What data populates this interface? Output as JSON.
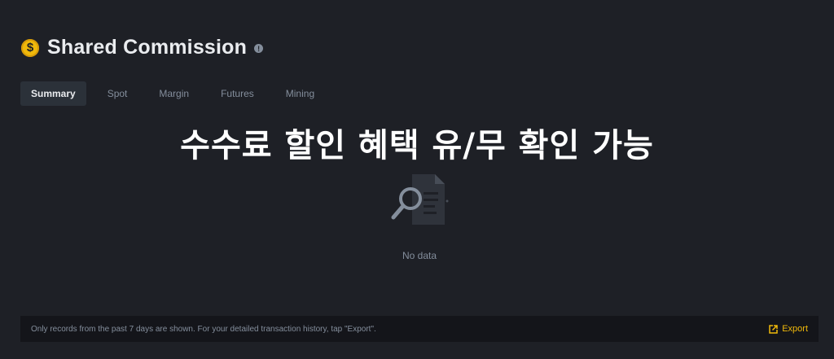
{
  "header": {
    "coin_symbol": "$",
    "title": "Shared Commission",
    "info_glyph": "!"
  },
  "tabs": [
    {
      "label": "Summary",
      "active": true
    },
    {
      "label": "Spot",
      "active": false
    },
    {
      "label": "Margin",
      "active": false
    },
    {
      "label": "Futures",
      "active": false
    },
    {
      "label": "Mining",
      "active": false
    }
  ],
  "overlay_caption": "수수료 할인 혜택 유/무 확인 가능",
  "empty_state": {
    "icon": "document-search-icon",
    "text": "No data"
  },
  "footer": {
    "note": "Only records from the past 7 days are shown. For your detailed transaction history, tap \"Export\".",
    "export_label": "Export",
    "export_icon": "export-icon"
  },
  "colors": {
    "accent": "#f0b90b",
    "background": "#1e2026",
    "tab_active_bg": "#2b3139",
    "muted_text": "#848e9c",
    "footer_bg": "#14151a"
  }
}
